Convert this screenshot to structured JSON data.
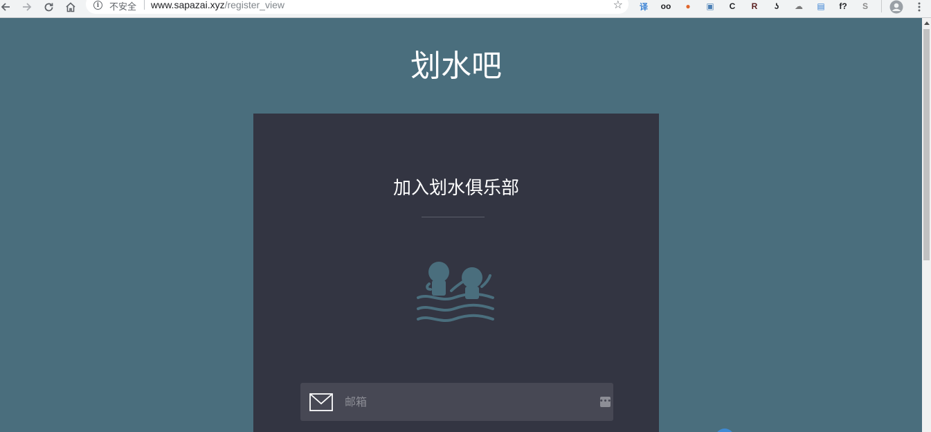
{
  "browser": {
    "security_label": "不安全",
    "url_host": "www.sapazai.xyz",
    "url_path": "/register_view",
    "extensions": [
      {
        "icon": "translate-extension-icon",
        "glyph": "译",
        "color": "#3a82d4"
      },
      {
        "icon": "glasses-extension-icon",
        "glyph": "oo",
        "color": "#202124"
      },
      {
        "icon": "palette-extension-icon",
        "glyph": "●",
        "color": "#e0662c"
      },
      {
        "icon": "image-extension-icon",
        "glyph": "▣",
        "color": "#4a7fb5"
      },
      {
        "icon": "c-extension-icon",
        "glyph": "C",
        "color": "#202124"
      },
      {
        "icon": "r-extension-icon",
        "glyph": "R",
        "color": "#5a1f1f"
      },
      {
        "icon": "hook-extension-icon",
        "glyph": "ʖ",
        "color": "#202124"
      },
      {
        "icon": "cloud-extension-icon",
        "glyph": "☁",
        "color": "#7a7a7a"
      },
      {
        "icon": "book-extension-icon",
        "glyph": "▤",
        "color": "#3a82d4"
      },
      {
        "icon": "formula-extension-icon",
        "glyph": "f?",
        "color": "#202124"
      },
      {
        "icon": "s-extension-icon",
        "glyph": "S",
        "color": "#8a8a8a"
      }
    ]
  },
  "page": {
    "site_title": "划水吧",
    "card_title": "加入划水俱乐部",
    "email_placeholder": "邮箱"
  },
  "colors": {
    "background": "#4a6e7d",
    "card": "#333542",
    "input": "#474854",
    "logo": "#4a6e7d"
  }
}
